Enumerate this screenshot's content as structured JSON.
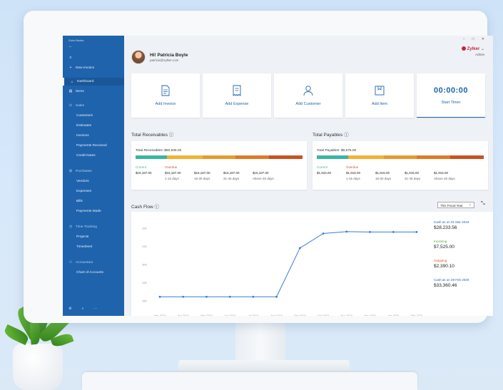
{
  "sidebar": {
    "app_title": "Zoho Books",
    "items": [
      {
        "label": "New Invoice",
        "icon": "plus-icon"
      },
      {
        "label": "Dashboard",
        "icon": "home-icon"
      },
      {
        "label": "Items",
        "icon": "items-icon"
      },
      {
        "label": "Sales",
        "icon": "sales-icon"
      },
      {
        "label": "Customers"
      },
      {
        "label": "Estimates"
      },
      {
        "label": "Invoices"
      },
      {
        "label": "Payments Received"
      },
      {
        "label": "Credit Notes"
      },
      {
        "label": "Purchases",
        "icon": "purchases-icon"
      },
      {
        "label": "Vendors"
      },
      {
        "label": "Expenses"
      },
      {
        "label": "Bills"
      },
      {
        "label": "Payments Made"
      },
      {
        "label": "Time Tracking",
        "icon": "clock-icon"
      },
      {
        "label": "Projects"
      },
      {
        "label": "Timesheet"
      },
      {
        "label": "Accountant",
        "icon": "accountant-icon"
      },
      {
        "label": "Chart of Accounts"
      }
    ]
  },
  "header": {
    "greeting": "Hi! Patricia Boyle",
    "email": "patricia@zylker.com",
    "org_name": "Zylker",
    "org_role": "Admin"
  },
  "quick_actions": [
    {
      "label": "Add Invoice",
      "icon": "invoice-icon"
    },
    {
      "label": "Add Expense",
      "icon": "receipt-icon"
    },
    {
      "label": "Add Customer",
      "icon": "person-icon"
    },
    {
      "label": "Add Item",
      "icon": "box-icon"
    }
  ],
  "timer": {
    "value": "00:00:00",
    "label": "Start Timer"
  },
  "receivables": {
    "title": "Total Receivables",
    "total": "Total Receivables: $80,935.00",
    "columns": [
      {
        "head": "Current",
        "value": "$16,187.00",
        "days": ""
      },
      {
        "head": "Overdue",
        "value": "$16,187.00",
        "days": "1-15 days"
      },
      {
        "head": "",
        "value": "$16,187.00",
        "days": "16-30 days"
      },
      {
        "head": "",
        "value": "$16,187.00",
        "days": "31-45 days"
      },
      {
        "head": "",
        "value": "$16,187.00",
        "days": "Above 45 days"
      }
    ]
  },
  "payables": {
    "title": "Total Payables",
    "total": "Total Payables: $9,575.00",
    "columns": [
      {
        "head": "Current",
        "value": "$1,915.00",
        "days": ""
      },
      {
        "head": "Overdue",
        "value": "$1,915.00",
        "days": "1-15 days"
      },
      {
        "head": "",
        "value": "$1,915.00",
        "days": "16-30 days"
      },
      {
        "head": "",
        "value": "$1,915.00",
        "days": "31-45 days"
      },
      {
        "head": "",
        "value": "$1,915.00",
        "days": "Above 45 days"
      }
    ]
  },
  "cashflow": {
    "title": "Cash Flow",
    "period": "This Fiscal Year",
    "side": [
      {
        "label": "Cash as on 01 Mar 2019",
        "value": "$28,233.56",
        "color": "#1f63ad"
      },
      {
        "label": "Incoming",
        "value": "$7,525.00",
        "color": "#5aa03a"
      },
      {
        "label": "Outgoing",
        "value": "$2,390.10",
        "color": "#d2562b"
      },
      {
        "label": "Cash as on 29 Feb 2020",
        "value": "$33,360.46",
        "color": "#1f63ad"
      }
    ]
  },
  "colors": {
    "accent": "#1f63ad",
    "current": "#3bb5a0",
    "overdue1": "#f2b233",
    "overdue2": "#e89a2e",
    "overdue3": "#df7a28",
    "overdue4": "#c9531f"
  },
  "chart_data": {
    "type": "line",
    "categories": [
      "Mar 2019",
      "Apr 2019",
      "May 2019",
      "Jun 2019",
      "Jul 2019",
      "Aug 2019",
      "Sep 2019",
      "Oct 2019",
      "Nov 2019",
      "Dec 2019",
      "Jan 2020",
      "Feb 2020"
    ],
    "ticks": [
      "28K",
      "29K",
      "30K",
      "31K",
      "32K"
    ],
    "series": [
      {
        "values": [
          28233,
          28233,
          28233,
          28233,
          28233,
          28233,
          30900,
          31700,
          31800,
          31780,
          31780,
          31780
        ]
      }
    ],
    "ylim": [
      27500,
      32500
    ],
    "grid": false
  }
}
